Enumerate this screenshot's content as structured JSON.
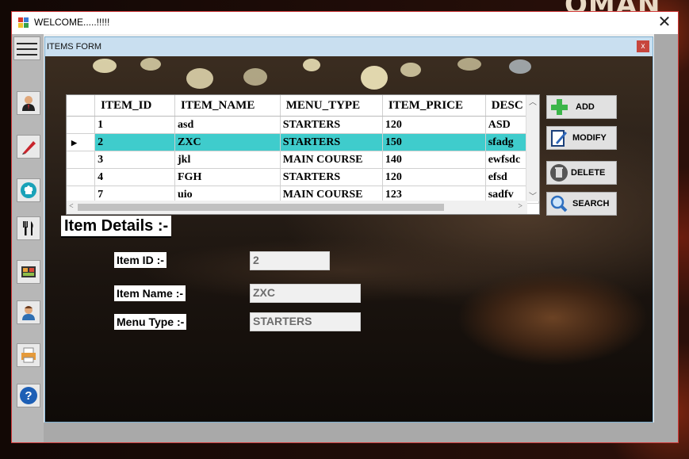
{
  "background_text": "OMAN",
  "window": {
    "title": "WELCOME.....!!!!!",
    "close_glyph": "✕"
  },
  "sidebar": {
    "menu_icon": "hamburger-icon",
    "items": [
      {
        "icon": "user-icon"
      },
      {
        "icon": "pen-icon"
      },
      {
        "icon": "chef-hat-icon"
      },
      {
        "icon": "fork-knife-icon"
      },
      {
        "icon": "food-icon"
      },
      {
        "icon": "customer-icon"
      },
      {
        "icon": "printer-icon"
      },
      {
        "icon": "help-icon",
        "glyph": "?"
      }
    ]
  },
  "child_form": {
    "title": "ITEMS FORM",
    "close_glyph": "x",
    "grid": {
      "columns": [
        "ITEM_ID",
        "ITEM_NAME",
        "MENU_TYPE",
        "ITEM_PRICE",
        "DESC"
      ],
      "rows": [
        {
          "id": "1",
          "name": "asd",
          "type": "STARTERS",
          "price": "120",
          "desc": "ASD"
        },
        {
          "id": "2",
          "name": "ZXC",
          "type": "STARTERS",
          "price": "150",
          "desc": "sfadg"
        },
        {
          "id": "3",
          "name": "jkl",
          "type": "MAIN COURSE",
          "price": "140",
          "desc": "ewfsdc"
        },
        {
          "id": "4",
          "name": "FGH",
          "type": "STARTERS",
          "price": "120",
          "desc": "efsd"
        },
        {
          "id": "7",
          "name": "uio",
          "type": "MAIN COURSE",
          "price": "123",
          "desc": "sadfv"
        }
      ],
      "selected_row_index": 1,
      "selected_row_color": "#3fcccc"
    },
    "buttons": {
      "add": "ADD",
      "modify": "MODIFY",
      "delete": "DELETE",
      "search": "SEARCH"
    },
    "details": {
      "heading": "Item Details :-",
      "item_id_label": "Item ID :-",
      "item_id_value": "2",
      "item_name_label": "Item Name :-",
      "item_name_value": "ZXC",
      "menu_type_label": "Menu Type :-",
      "menu_type_value": "STARTERS"
    }
  }
}
